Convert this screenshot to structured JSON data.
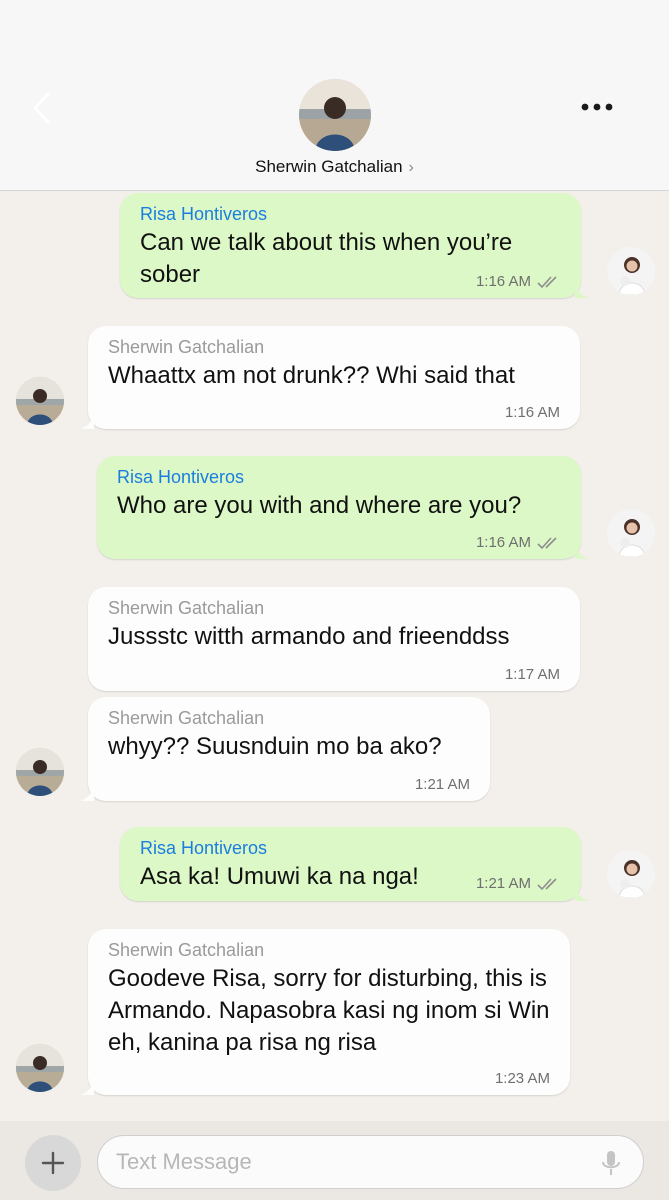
{
  "header": {
    "contact_name": "Sherwin Gatchalian",
    "chevron": "›"
  },
  "messages": [
    {
      "direction": "out",
      "sender": "Risa Hontiveros",
      "text": "Can we talk about this when you’re sober",
      "time": "1:16 AM",
      "status": "read"
    },
    {
      "direction": "in",
      "sender": "Sherwin Gatchalian",
      "text": "Whaattx am not drunk?? Whi said that",
      "time": "1:16 AM"
    },
    {
      "direction": "out",
      "sender": "Risa Hontiveros",
      "text": "Who are you with and where are you?",
      "time": "1:16 AM",
      "status": "read"
    },
    {
      "direction": "in",
      "sender": "Sherwin Gatchalian",
      "text": "Jussstc witth armando and frieenddss",
      "time": "1:17 AM"
    },
    {
      "direction": "in",
      "sender": "Sherwin Gatchalian",
      "text": "whyy?? Suusnduin mo ba ako?",
      "time": "1:21 AM"
    },
    {
      "direction": "out",
      "sender": "Risa Hontiveros",
      "text": "Asa ka! Umuwi ka na nga!",
      "time": "1:21 AM",
      "status": "read"
    },
    {
      "direction": "in",
      "sender": "Sherwin Gatchalian",
      "text": "Goodeve Risa, sorry for disturbing, this is Armando. Napasobra kasi ng inom si Win eh, kanina pa risa ng risa",
      "time": "1:23 AM"
    }
  ],
  "composer": {
    "placeholder": "Text Message"
  },
  "colors": {
    "outgoing_bubble": "#dcf8c6",
    "incoming_bubble": "#fdfdfd",
    "outgoing_sender": "#1a7ee0",
    "incoming_sender": "#9a9a9a",
    "background": "#f3efea"
  },
  "icons": {
    "back": "back-chevron-icon",
    "more": "more-dots-icon",
    "add": "plus-icon",
    "mic": "microphone-icon",
    "read": "double-check-icon"
  }
}
